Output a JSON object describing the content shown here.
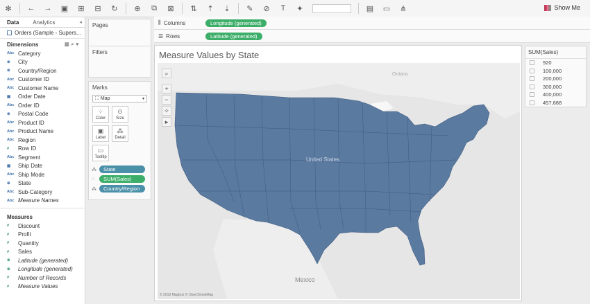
{
  "toolbar": {
    "show_me": "Show Me"
  },
  "left_panel": {
    "tabs": [
      {
        "label": "Data"
      },
      {
        "label": "Analytics"
      }
    ],
    "datasource": "Orders (Sample - Supers...",
    "dimensions_title": "Dimensions",
    "dimensions": [
      {
        "label": "Category",
        "type": "Abc"
      },
      {
        "label": "City",
        "type": "geo"
      },
      {
        "label": "Country/Region",
        "type": "geo"
      },
      {
        "label": "Customer ID",
        "type": "Abc"
      },
      {
        "label": "Customer Name",
        "type": "Abc"
      },
      {
        "label": "Order Date",
        "type": "date"
      },
      {
        "label": "Order ID",
        "type": "Abc"
      },
      {
        "label": "Postal Code",
        "type": "geo"
      },
      {
        "label": "Product ID",
        "type": "Abc"
      },
      {
        "label": "Product Name",
        "type": "Abc"
      },
      {
        "label": "Region",
        "type": "Abc"
      },
      {
        "label": "Row ID",
        "type": "num"
      },
      {
        "label": "Segment",
        "type": "Abc"
      },
      {
        "label": "Ship Date",
        "type": "date"
      },
      {
        "label": "Ship Mode",
        "type": "Abc"
      },
      {
        "label": "State",
        "type": "geo"
      },
      {
        "label": "Sub-Category",
        "type": "Abc"
      },
      {
        "label": "Measure Names",
        "type": "Abc"
      }
    ],
    "measures_title": "Measures",
    "measures": [
      {
        "label": "Discount",
        "type": "num"
      },
      {
        "label": "Profit",
        "type": "num"
      },
      {
        "label": "Quantity",
        "type": "num"
      },
      {
        "label": "Sales",
        "type": "num"
      },
      {
        "label": "Latitude (generated)",
        "type": "geo"
      },
      {
        "label": "Longitude (generated)",
        "type": "geo"
      },
      {
        "label": "Number of Records",
        "type": "num"
      },
      {
        "label": "Measure Values",
        "type": "num"
      }
    ]
  },
  "cards": {
    "pages": "Pages",
    "filters": "Filters",
    "marks": "Marks",
    "mark_type": "Map",
    "buttons": [
      {
        "label": "Color"
      },
      {
        "label": "Size"
      },
      {
        "label": "Label"
      },
      {
        "label": "Detail"
      },
      {
        "label": "Tooltip"
      }
    ],
    "pills": [
      {
        "label": "State",
        "kind": "blue"
      },
      {
        "label": "SUM(Sales)",
        "kind": "green"
      },
      {
        "label": "Country/Region",
        "kind": "blue"
      }
    ]
  },
  "shelves": {
    "columns_label": "Columns",
    "columns_pill": "Longitude (generated)",
    "rows_label": "Rows",
    "rows_pill": "Latitude (generated)"
  },
  "sheet": {
    "title": "Measure Values by State",
    "map_labels": {
      "ontario": "Ontario",
      "united_states": "United States",
      "mexico": "Mexico"
    },
    "copyright": "© 2019 Mapbox © OpenStreetMap",
    "fill_color": "#5b7aa0"
  },
  "legend": {
    "title": "SUM(Sales)",
    "values": [
      "920",
      "100,000",
      "200,000",
      "300,000",
      "400,000",
      "457,688"
    ]
  }
}
